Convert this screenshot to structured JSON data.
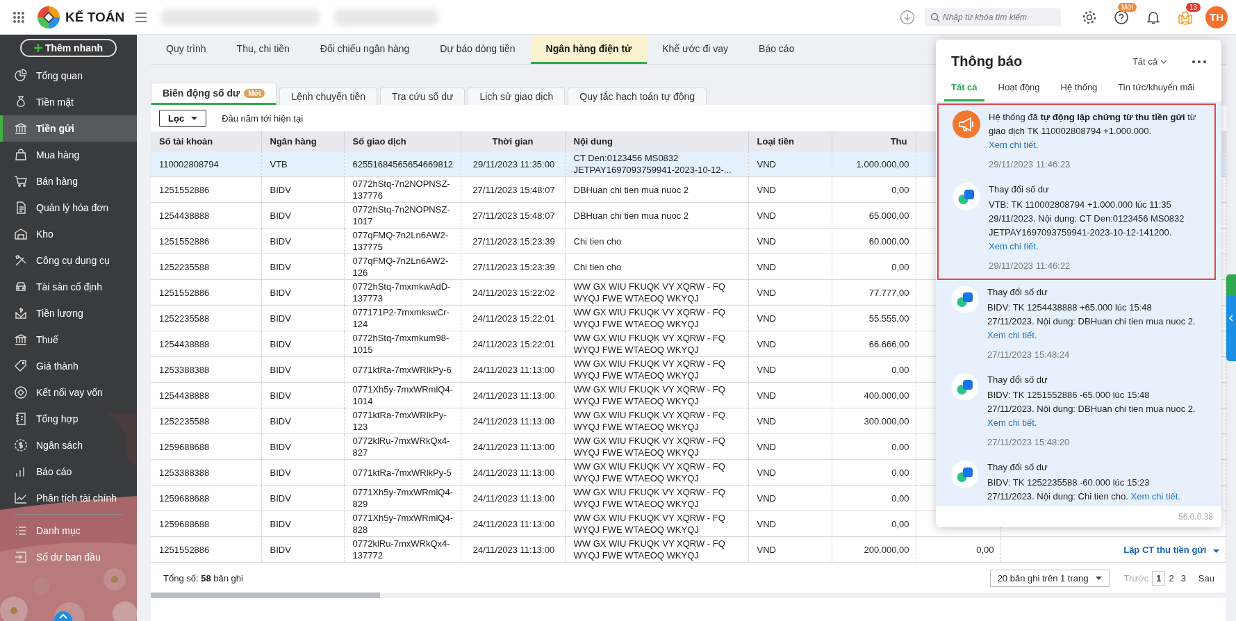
{
  "topbar": {
    "app_name": "KẾ TOÁN",
    "search": {
      "placeholder": "Nhập từ khóa tìm kiếm"
    },
    "help_badge": "Mới",
    "gift_badge": "13",
    "avatar": "TH"
  },
  "sidebar": {
    "quick_add": "Thêm nhanh",
    "items": [
      {
        "label": "Tổng quan",
        "selected": false
      },
      {
        "label": "Tiền mặt",
        "selected": false
      },
      {
        "label": "Tiền gửi",
        "selected": true
      },
      {
        "label": "Mua hàng",
        "selected": false
      },
      {
        "label": "Bán hàng",
        "selected": false
      },
      {
        "label": "Quản lý hóa đơn",
        "selected": false
      },
      {
        "label": "Kho",
        "selected": false
      },
      {
        "label": "Công cụ dụng cụ",
        "selected": false
      },
      {
        "label": "Tài sản cố định",
        "selected": false
      },
      {
        "label": "Tiền lương",
        "selected": false
      },
      {
        "label": "Thuế",
        "selected": false
      },
      {
        "label": "Giá thành",
        "selected": false
      },
      {
        "label": "Kết nối vay vốn",
        "selected": false
      },
      {
        "label": "Tổng hợp",
        "selected": false
      },
      {
        "label": "Ngân sách",
        "selected": false
      },
      {
        "label": "Báo cáo",
        "selected": false
      },
      {
        "label": "Phân tích tài chính",
        "selected": false
      }
    ],
    "bottom_items": [
      {
        "label": "Danh mục",
        "selected": false
      },
      {
        "label": "Số dư ban đầu",
        "selected": false
      }
    ]
  },
  "tabs": [
    {
      "label": "Quy trình",
      "selected": false
    },
    {
      "label": "Thu, chi tiền",
      "selected": false
    },
    {
      "label": "Đối chiếu ngân hàng",
      "selected": false
    },
    {
      "label": "Dự báo dòng tiền",
      "selected": false
    },
    {
      "label": "Ngân hàng điện tử",
      "selected": true
    },
    {
      "label": "Khế ước đi vay",
      "selected": false
    },
    {
      "label": "Báo cáo",
      "selected": false
    }
  ],
  "subtabs": [
    {
      "label": "Biến động số dư",
      "badge": "Mới",
      "selected": true
    },
    {
      "label": "Lệnh chuyển tiền",
      "selected": false
    },
    {
      "label": "Tra cứu số dư",
      "selected": false
    },
    {
      "label": "Lịch sử giao dịch",
      "selected": false
    },
    {
      "label": "Quy tắc hạch toán tự động",
      "selected": false
    }
  ],
  "filter": {
    "button": "Lọc",
    "period": "Đầu năm tới hiện tại"
  },
  "table": {
    "columns": [
      "Số tài khoản",
      "Ngân hàng",
      "Số giao dịch",
      "Thời gian",
      "Nội dung",
      "Loại tiền",
      "Thu"
    ],
    "rows": [
      {
        "selected": true,
        "cells": [
          "110002808794",
          "VTB",
          "62551684565654669812",
          "29/11/2023 11:35:00",
          "CT Den:0123456 MS0832 JETPAY1697093759941-2023-10-12-...",
          "VND",
          "1.000.000,00"
        ]
      },
      {
        "selected": false,
        "cells": [
          "1251552886",
          "BIDV",
          "0772hStq-7n2NOPNSZ-137776",
          "27/11/2023 15:48:07",
          "DBHuan chi tien mua nuoc 2",
          "VND",
          "0,00"
        ]
      },
      {
        "selected": false,
        "cells": [
          "1254438888",
          "BIDV",
          "0772hStq-7n2NOPNSZ-1017",
          "27/11/2023 15:48:07",
          "DBHuan chi tien mua nuoc 2",
          "VND",
          "65.000,00"
        ]
      },
      {
        "selected": false,
        "cells": [
          "1251552886",
          "BIDV",
          "077qFMQ-7n2Ln6AW2-137775",
          "27/11/2023 15:23:39",
          "Chi tien cho",
          "VND",
          "60.000,00"
        ]
      },
      {
        "selected": false,
        "cells": [
          "1252235588",
          "BIDV",
          "077qFMQ-7n2Ln6AW2-126",
          "27/11/2023 15:23:39",
          "Chi tien cho",
          "VND",
          "0,00"
        ]
      },
      {
        "selected": false,
        "cells": [
          "1251552886",
          "BIDV",
          "0772hStq-7mxmkwAdD-137773",
          "24/11/2023 15:22:02",
          "WW GX WIU FKUQK VY XQRW - FQ WYQJ FWE WTAEOQ WKYQJ",
          "VND",
          "77.777,00"
        ]
      },
      {
        "selected": false,
        "cells": [
          "1252235588",
          "BIDV",
          "077171P2-7mxmkswCr-124",
          "24/11/2023 15:22:01",
          "WW GX WIU FKUQK VY XQRW - FQ WYQJ FWE WTAEOQ WKYQJ",
          "VND",
          "55.555,00"
        ]
      },
      {
        "selected": false,
        "cells": [
          "1254438888",
          "BIDV",
          "0772hStq-7mxmkum98-1015",
          "24/11/2023 15:22:01",
          "WW GX WIU FKUQK VY XQRW - FQ WYQJ FWE WTAEOQ WKYQJ",
          "VND",
          "66.666,00"
        ]
      },
      {
        "selected": false,
        "cells": [
          "1253388388",
          "BIDV",
          "0771ktRa-7mxWRlkPy-6",
          "24/11/2023 11:13:00",
          "WW GX WIU FKUQK VY XQRW - FQ WYQJ FWE WTAEOQ WKYQJ",
          "VND",
          "0,00"
        ]
      },
      {
        "selected": false,
        "cells": [
          "1254438888",
          "BIDV",
          "0771Xh5y-7mxWRmlQ4-1014",
          "24/11/2023 11:13:00",
          "WW GX WIU FKUQK VY XQRW - FQ WYQJ FWE WTAEOQ WKYQJ",
          "VND",
          "400.000,00"
        ]
      },
      {
        "selected": false,
        "cells": [
          "1252235588",
          "BIDV",
          "0771ktRa-7mxWRlkPy-123",
          "24/11/2023 11:13:00",
          "WW GX WIU FKUQK VY XQRW - FQ WYQJ FWE WTAEOQ WKYQJ",
          "VND",
          "300.000,00"
        ]
      },
      {
        "selected": false,
        "cells": [
          "1259688688",
          "BIDV",
          "0772klRu-7mxWRkQx4-827",
          "24/11/2023 11:13:00",
          "WW GX WIU FKUQK VY XQRW - FQ WYQJ FWE WTAEOQ WKYQJ",
          "VND",
          "0,00"
        ]
      },
      {
        "selected": false,
        "cells": [
          "1253388388",
          "BIDV",
          "0771ktRa-7mxWRlkPy-5",
          "24/11/2023 11:13:00",
          "WW GX WIU FKUQK VY XQRW - FQ WYQJ FWE WTAEOQ WKYQJ",
          "VND",
          "0,00"
        ]
      },
      {
        "selected": false,
        "cells": [
          "1259688688",
          "BIDV",
          "0771Xh5y-7mxWRmlQ4-829",
          "24/11/2023 11:13:00",
          "WW GX WIU FKUQK VY XQRW - FQ WYQJ FWE WTAEOQ WKYQJ",
          "VND",
          "0,00"
        ]
      },
      {
        "selected": false,
        "cells": [
          "1259688688",
          "BIDV",
          "0771Xh5y-7mxWRmlQ4-828",
          "24/11/2023 11:13:00",
          "WW GX WIU FKUQK VY XQRW - FQ WYQJ FWE WTAEOQ WKYQJ",
          "VND",
          "0,00"
        ]
      },
      {
        "selected": false,
        "cells": [
          "1251552886",
          "BIDV",
          "0772klRu-7mxWRkQx4-137772",
          "24/11/2023 11:13:00",
          "WW GX WIU FKUQK VY XQRW - FQ WYQJ FWE WTAEOQ WKYQJ",
          "VND",
          "200.000,00"
        ],
        "column_8": "0,00",
        "action": "Lập CT thu tiền gửi"
      }
    ]
  },
  "footer": {
    "total_label": "Tổng số:",
    "total": "58",
    "total_unit": "bản ghi",
    "page_size": "20 bản ghi trên 1 trang",
    "prev": "Trước",
    "pages": [
      {
        "label": "1",
        "selected": true
      },
      {
        "label": "2",
        "selected": false
      },
      {
        "label": "3",
        "selected": false
      }
    ],
    "next": "Sau"
  },
  "notifications": {
    "title": "Thông báo",
    "filter": "Tất cả",
    "tabs": [
      {
        "label": "Tất cả",
        "selected": true
      },
      {
        "label": "Hoạt động",
        "selected": false
      },
      {
        "label": "Hệ thống",
        "selected": false
      },
      {
        "label": "Tin tức/khuyến mãi",
        "selected": false
      }
    ],
    "items": [
      {
        "kind": "system",
        "highlighted": true,
        "text": "Hệ thống đã **tự động lập chứng từ thu tiền gửi** từ giao dịch TK 110002808794 +1.000.000.",
        "link": "Xem chi tiết.",
        "time": "29/11/2023 11:46:23"
      },
      {
        "kind": "balance",
        "highlighted": true,
        "title": "Thay đổi số dư",
        "text": "VTB: TK 110002808794 +1.000.000 lúc 11:35 29/11/2023. Nội dung: CT Den:0123456 MS0832 JETPAY1697093759941-2023-10-12-141200.",
        "link": "Xem chi tiết.",
        "time": "29/11/2023 11:46:22"
      },
      {
        "kind": "balance",
        "highlighted": false,
        "title": "Thay đổi số dư",
        "text": "BIDV: TK 1254438888 +65.000 lúc 15:48 27/11/2023. Nội dung: DBHuan chi tien mua nuoc 2.",
        "link": "Xem chi tiết.",
        "time": "27/11/2023 15:48:24"
      },
      {
        "kind": "balance",
        "highlighted": false,
        "title": "Thay đổi số dư",
        "text": "BIDV: TK 1251552886 -65.000 lúc 15:48 27/11/2023. Nội dung: DBHuan chi tien mua nuoc 2.",
        "link": "Xem chi tiết.",
        "time": "27/11/2023 15:48:20"
      },
      {
        "kind": "balance",
        "highlighted": false,
        "title": "Thay đổi số dư",
        "text": "BIDV: TK 1252235588 -60.000 lúc 15:23 27/11/2023. Nội dung: Chi tien cho.",
        "link": "Xem chi tiết."
      }
    ],
    "version": "56.0.0.38"
  }
}
